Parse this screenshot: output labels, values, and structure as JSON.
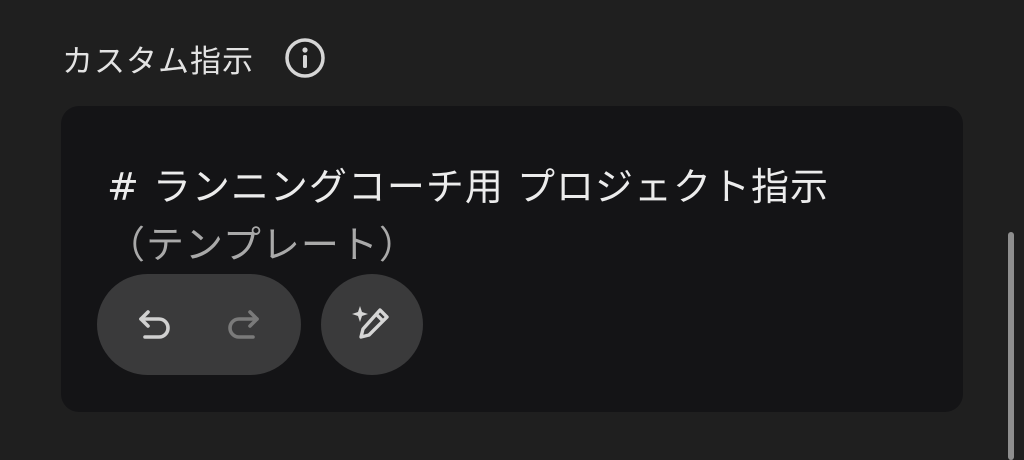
{
  "section": {
    "title": "カスタム指示",
    "info_icon": "info-icon"
  },
  "editor": {
    "line1": "# ランニングコーチ用 プロジェクト指示",
    "line2": "（テンプレート）"
  },
  "toolbar": {
    "undo_icon": "undo-icon",
    "redo_icon": "redo-icon",
    "ai_edit_icon": "sparkle-pencil-icon"
  },
  "colors": {
    "background": "#1f1f1f",
    "editor_background": "#141416",
    "button_background": "#3a3a3b",
    "text_primary": "#ececec",
    "text_secondary": "#a9a9a9",
    "icon_enabled": "#d0d0d0",
    "icon_disabled": "#7a7a7a"
  }
}
